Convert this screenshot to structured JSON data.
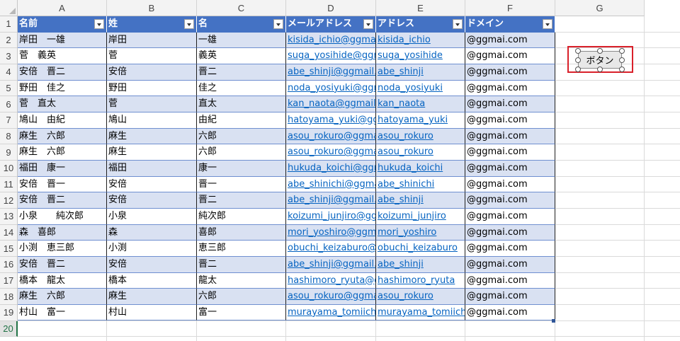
{
  "columns": [
    "A",
    "B",
    "C",
    "D",
    "E",
    "F",
    "G"
  ],
  "rows": [
    "1",
    "2",
    "3",
    "4",
    "5",
    "6",
    "7",
    "8",
    "9",
    "10",
    "11",
    "12",
    "13",
    "14",
    "15",
    "16",
    "17",
    "18",
    "19",
    "20"
  ],
  "table": {
    "headers": [
      "名前",
      "姓",
      "名",
      "メールアドレス",
      "アドレス",
      "ドメイン"
    ],
    "rows": [
      [
        "岸田　一雄",
        "岸田",
        "一雄",
        "kisida_ichio@ggmai",
        "kisida_ichio",
        "@ggmai.com"
      ],
      [
        "菅　義英",
        "菅",
        "義英",
        "suga_yosihide@ggm",
        "suga_yosihide",
        "@ggmai.com"
      ],
      [
        "安倍　晋二",
        "安倍",
        "晋二",
        "abe_shinji@ggmail.c",
        "abe_shinji",
        "@ggmai.com"
      ],
      [
        "野田　佳之",
        "野田",
        "佳之",
        "noda_yosiyuki@ggm",
        "noda_yosiyuki",
        "@ggmai.com"
      ],
      [
        "菅　直太",
        "菅",
        "直太",
        "kan_naota@ggmail.c",
        "kan_naota",
        "@ggmai.com"
      ],
      [
        "鳩山　由紀",
        "鳩山",
        "由紀",
        "hatoyama_yuki@gg",
        "hatoyama_yuki",
        "@ggmai.com"
      ],
      [
        "麻生　六郎",
        "麻生",
        "六郎",
        "asou_rokuro@ggma",
        "asou_rokuro",
        "@ggmai.com"
      ],
      [
        "麻生　六郎",
        "麻生",
        "六郎",
        "asou_rokuro@ggma",
        "asou_rokuro",
        "@ggmai.com"
      ],
      [
        "福田　康一",
        "福田",
        "康一",
        "hukuda_koichi@ggm",
        "hukuda_koichi",
        "@ggmai.com"
      ],
      [
        "安倍　晋一",
        "安倍",
        "晋一",
        "abe_shinichi@ggma",
        "abe_shinichi",
        "@ggmai.com"
      ],
      [
        "安倍　晋二",
        "安倍",
        "晋二",
        "abe_shinji@ggmail.c",
        "abe_shinji",
        "@ggmai.com"
      ],
      [
        "小泉　　純次郎",
        "小泉",
        "純次郎",
        "koizumi_junjiro@gg",
        "koizumi_junjiro",
        "@ggmai.com"
      ],
      [
        "森　喜郎",
        "森",
        "喜郎",
        "mori_yoshiro@ggma",
        "mori_yoshiro",
        "@ggmai.com"
      ],
      [
        "小渕　恵三郎",
        "小渕",
        "恵三郎",
        "obuchi_keizaburo@g",
        "obuchi_keizaburo",
        "@ggmai.com"
      ],
      [
        "安倍　晋二",
        "安倍",
        "晋二",
        "abe_shinji@ggmail.c",
        "abe_shinji",
        "@ggmai.com"
      ],
      [
        "橋本　龍太",
        "橋本",
        "龍太",
        "hashimoro_ryuta@g",
        "hashimoro_ryuta",
        "@ggmai.com"
      ],
      [
        "麻生　六郎",
        "麻生",
        "六郎",
        "asou_rokuro@ggma",
        "asou_rokuro",
        "@ggmai.com"
      ],
      [
        "村山　富一",
        "村山",
        "富一",
        "murayama_tomiichi",
        "murayama_tomiichi",
        "@ggmai.com"
      ]
    ]
  },
  "form_button": {
    "label": "ボタン"
  },
  "selected_row": "20",
  "colors": {
    "header_bg": "#4472c4",
    "band_bg": "#d9e1f2",
    "link": "#0563c1",
    "highlight_border": "#d9202a"
  }
}
